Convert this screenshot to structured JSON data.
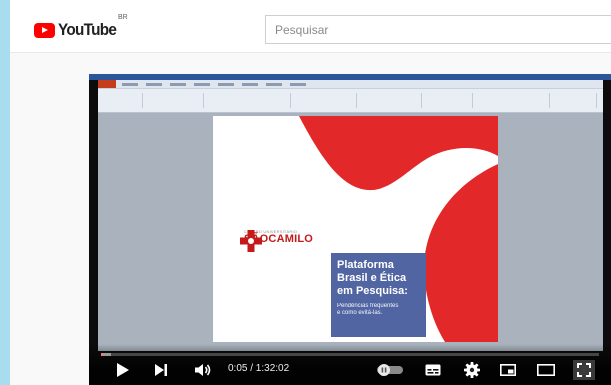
{
  "header": {
    "logo_text": "YouTube",
    "region": "BR",
    "search_placeholder": "Pesquisar"
  },
  "colors": {
    "youtube_red": "#ff0000",
    "slide_red": "#e3282a",
    "title_box_blue": "#5165a3",
    "sao_camilo_red": "#c41a1a"
  },
  "slide": {
    "logo_small": "CENTRO UNIVERSITÁRIO",
    "logo_big": "SÃOCAMILO",
    "title": "Plataforma\nBrasil e Ética\nem Pesquisa:",
    "subtitle": "Pendências frequentes\ne como evitá-las."
  },
  "player": {
    "current_time": "0:05",
    "duration": "1:32:02",
    "time_display": "0:05 / 1:32:02",
    "progress_fraction": 0.001,
    "buffer_fraction": 0.02,
    "icons": [
      "play-icon",
      "next-icon",
      "volume-icon",
      "autoplay-toggle-icon",
      "subtitles-icon",
      "settings-icon",
      "miniplayer-icon",
      "theater-mode-icon",
      "fullscreen-icon"
    ]
  }
}
